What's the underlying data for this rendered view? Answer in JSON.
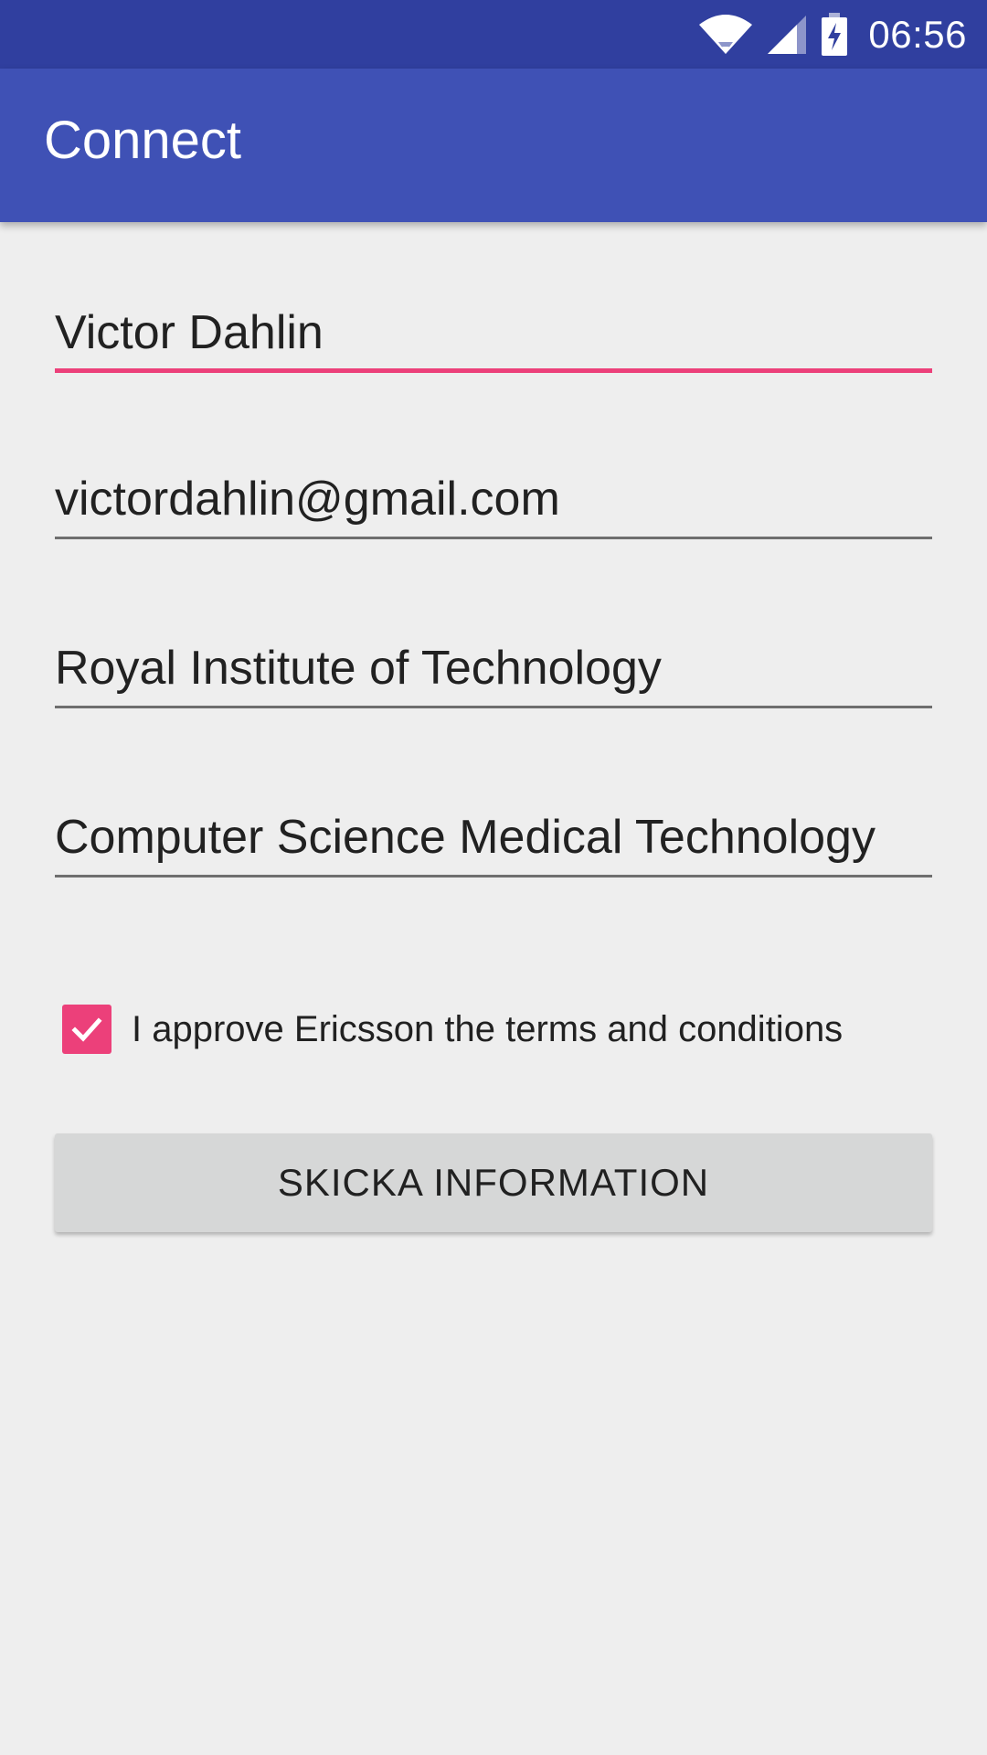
{
  "status_bar": {
    "time": "06:56",
    "icons": [
      "wifi-icon",
      "signal-icon",
      "battery-charging-icon"
    ],
    "background": "#303f9f"
  },
  "app_bar": {
    "title": "Connect",
    "background": "#3f51b5"
  },
  "form": {
    "name_value": "Victor Dahlin",
    "email_value": "victordahlin@gmail.com",
    "school_value": "Royal Institute of Technology",
    "program_value": "Computer Science Medical Technology",
    "focused_field": "name",
    "accent_color": "#ec407a"
  },
  "terms": {
    "checked": true,
    "label": "I approve Ericsson the terms and conditions"
  },
  "submit": {
    "label": "SKICKA INFORMATION"
  }
}
